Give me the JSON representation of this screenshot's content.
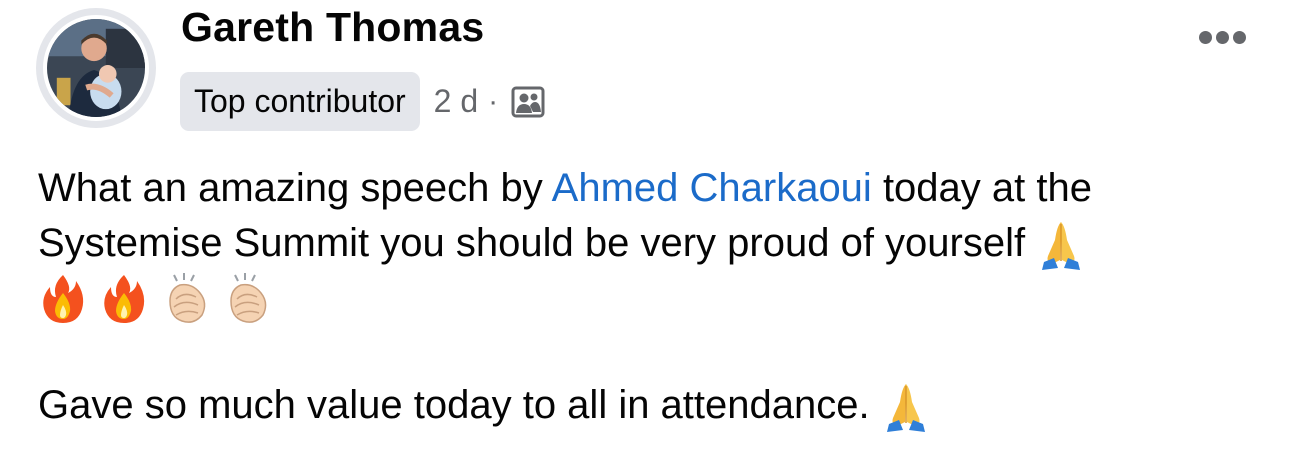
{
  "author": {
    "name": "Gareth Thomas",
    "badge": "Top contributor",
    "time": "2 d",
    "separator": "·",
    "audience_icon": "group-audience-icon"
  },
  "menu": {
    "icon": "more-horizontal-icon"
  },
  "post": {
    "line1_prefix": "What an amazing speech by ",
    "mention": "Ahmed Charkaoui",
    "line1_suffix": " today at the",
    "line2": "Systemise Summit you should be very proud of yourself ",
    "emoji_row": [
      "fire",
      "fire",
      "clapping-hands",
      "clapping-hands"
    ],
    "paragraph2": "Gave so much value today to all in attendance. ",
    "trailing_emoji": "folded-hands"
  },
  "colors": {
    "mention": "#1b6bc9",
    "secondary_text": "#65676b",
    "badge_bg": "#e4e6eb"
  }
}
